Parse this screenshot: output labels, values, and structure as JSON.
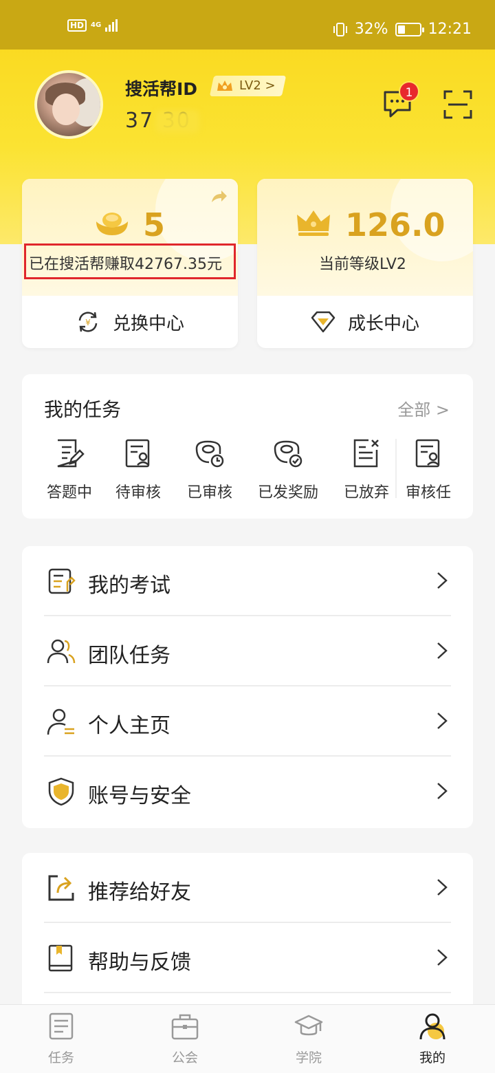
{
  "status_bar": {
    "hd": "HD",
    "network": "4G",
    "battery_percent": "32%",
    "time": "12:21"
  },
  "profile": {
    "name_label": "搜活帮ID",
    "level_badge": "LV2 >",
    "user_id": "37    30",
    "message_count": "1"
  },
  "cards": {
    "earnings": {
      "value": "5",
      "subtitle": "已在搜活帮赚取42767.35元",
      "action": "兑换中心"
    },
    "growth": {
      "value": "126.0",
      "subtitle": "当前等级LV2",
      "action": "成长中心"
    }
  },
  "tasks": {
    "title": "我的任务",
    "all": "全部 >",
    "items": [
      {
        "label": "答题中",
        "icon": "edit-doc-icon"
      },
      {
        "label": "待审核",
        "icon": "pending-review-icon"
      },
      {
        "label": "已审核",
        "icon": "reviewed-icon"
      },
      {
        "label": "已发奖励",
        "icon": "reward-sent-icon"
      },
      {
        "label": "已放弃",
        "icon": "abandoned-icon"
      },
      {
        "label": "审核任",
        "icon": "review-task-icon"
      }
    ]
  },
  "menu1": [
    {
      "label": "我的考试",
      "icon": "exam-icon"
    },
    {
      "label": "团队任务",
      "icon": "team-icon"
    },
    {
      "label": "个人主页",
      "icon": "profile-icon"
    },
    {
      "label": "账号与安全",
      "icon": "shield-icon"
    }
  ],
  "menu2": [
    {
      "label": "推荐给好友",
      "icon": "share-icon"
    },
    {
      "label": "帮助与反馈",
      "icon": "help-book-icon"
    }
  ],
  "tabbar": [
    {
      "label": "任务",
      "icon": "task-list-icon",
      "active": false
    },
    {
      "label": "公会",
      "icon": "briefcase-icon",
      "active": false
    },
    {
      "label": "学院",
      "icon": "graduation-cap-icon",
      "active": false
    },
    {
      "label": "我的",
      "icon": "user-icon",
      "active": true
    }
  ],
  "colors": {
    "brand_yellow": "#f9d61a",
    "gold": "#d9a21f",
    "badge_red": "#e8282d",
    "highlight_red": "#e0262b"
  }
}
